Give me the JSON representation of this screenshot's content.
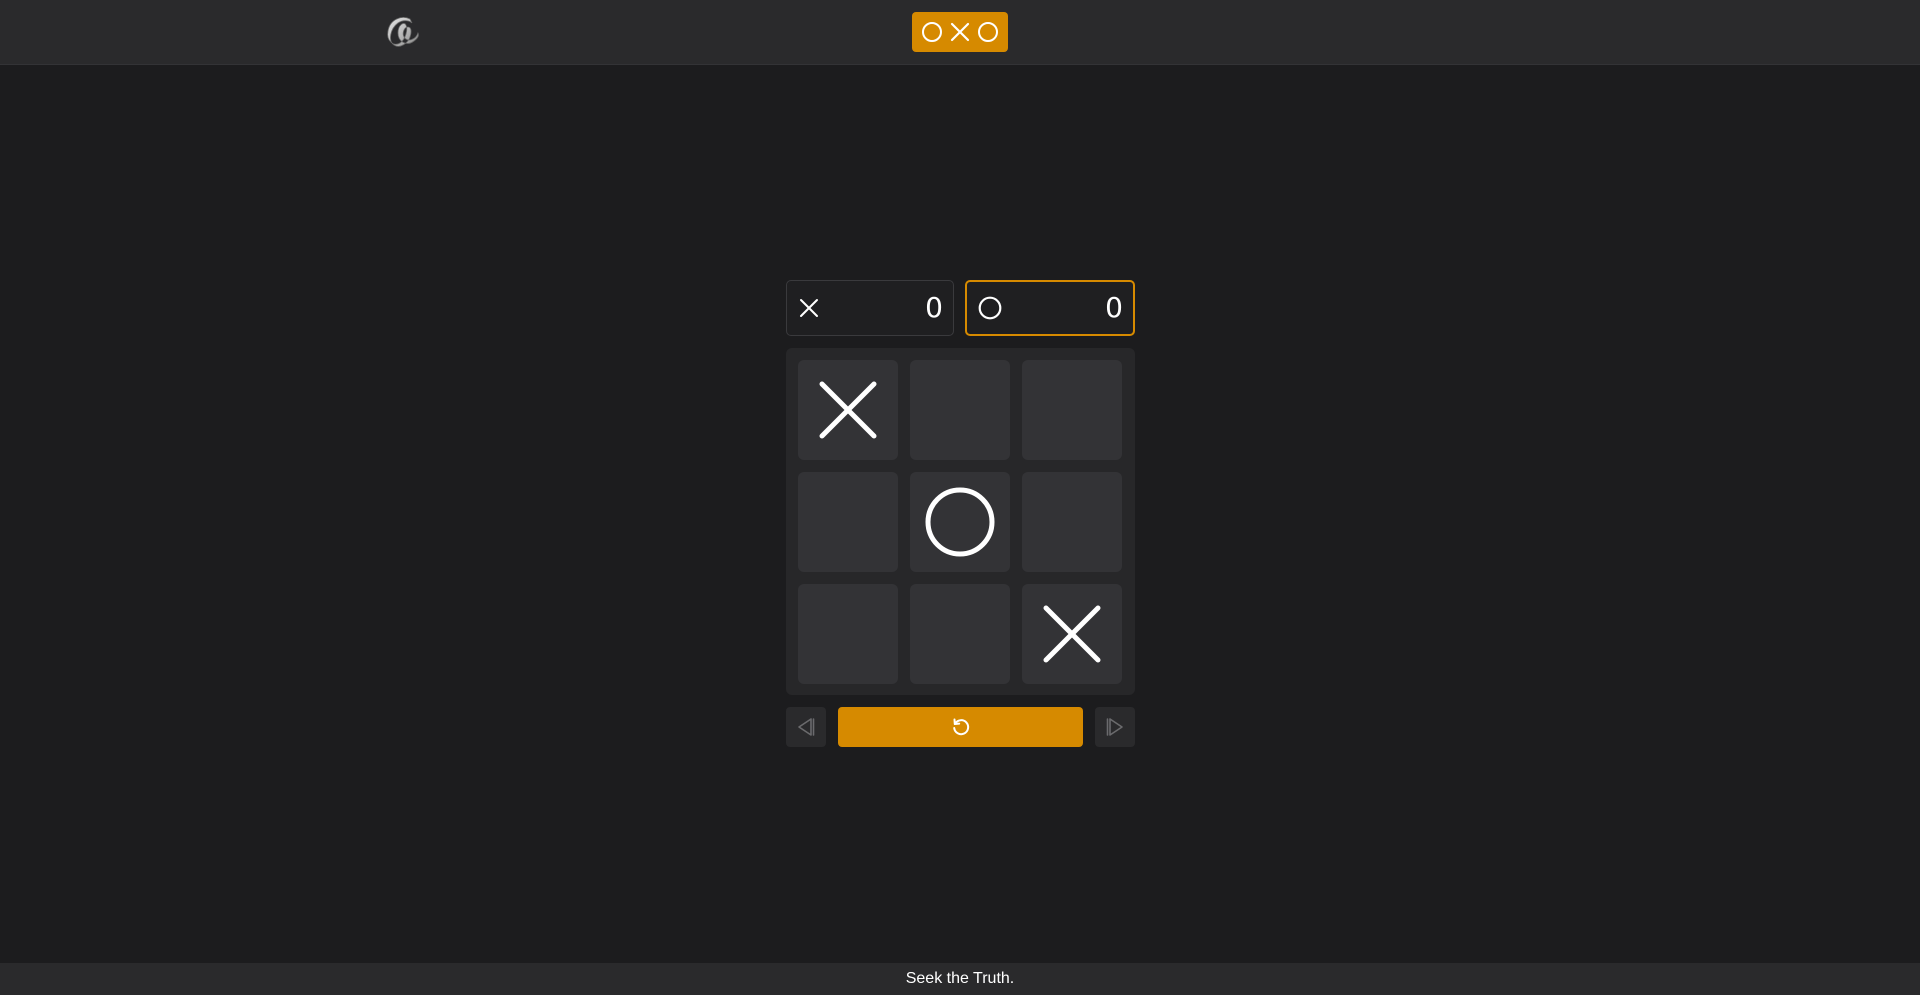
{
  "header": {
    "logo_icon": "ampersand-logo-icon",
    "brand_icons": [
      "circle-icon",
      "cross-icon",
      "circle-icon"
    ],
    "brand_color": "#d68a00"
  },
  "scoreboard": {
    "players": [
      {
        "symbol": "X",
        "icon": "cross-icon",
        "score": "0",
        "active": false
      },
      {
        "symbol": "O",
        "icon": "circle-icon",
        "score": "0",
        "active": true
      }
    ],
    "active_border_color": "#d68a00"
  },
  "board": {
    "cells": [
      "X",
      "",
      "",
      "",
      "O",
      "",
      "",
      "",
      "X"
    ]
  },
  "controls": {
    "prev_icon": "step-back-icon",
    "reset_icon": "restart-icon",
    "next_icon": "step-forward-icon",
    "reset_color": "#d68a00"
  },
  "footer": {
    "tagline": "Seek the Truth."
  }
}
